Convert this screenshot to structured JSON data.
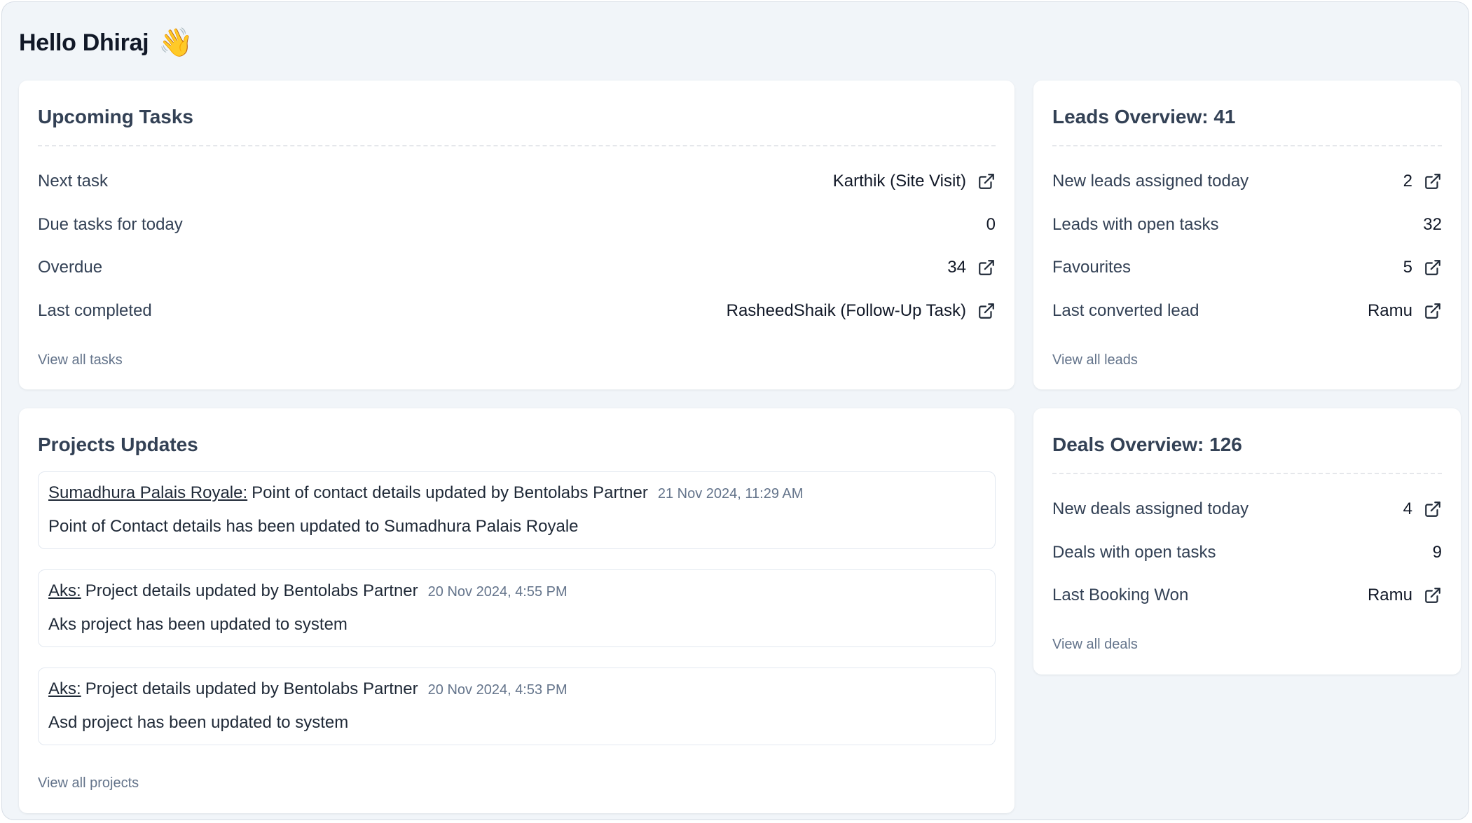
{
  "greeting": {
    "text": "Hello Dhiraj",
    "emoji": "👋"
  },
  "tasks": {
    "title": "Upcoming Tasks",
    "rows": [
      {
        "label": "Next task",
        "value": "Karthik (Site Visit)"
      },
      {
        "label": "Due tasks for today",
        "value": "0"
      },
      {
        "label": "Overdue",
        "value": "34"
      },
      {
        "label": "Last completed",
        "value": "RasheedShaik (Follow-Up Task)"
      }
    ],
    "view_all": "View all tasks"
  },
  "leads": {
    "title": "Leads Overview: 41",
    "rows": [
      {
        "label": "New leads assigned today",
        "value": "2"
      },
      {
        "label": "Leads with open tasks",
        "value": "32"
      },
      {
        "label": "Favourites",
        "value": "5"
      },
      {
        "label": "Last converted lead",
        "value": "Ramu"
      }
    ],
    "view_all": "View all leads"
  },
  "projects": {
    "title": "Projects Updates",
    "updates": [
      {
        "project": "Sumadhura Palais Royale:",
        "message": "Point of contact details updated by Bentolabs Partner",
        "time": "21 Nov 2024, 11:29 AM",
        "detail": "Point of Contact details has been updated to Sumadhura Palais Royale"
      },
      {
        "project": "Aks:",
        "message": "Project details updated by Bentolabs Partner",
        "time": "20 Nov 2024, 4:55 PM",
        "detail": "Aks project has been updated to system"
      },
      {
        "project": "Aks:",
        "message": "Project details updated by Bentolabs Partner",
        "time": "20 Nov 2024, 4:53 PM",
        "detail": "Asd project has been updated to system"
      }
    ],
    "view_all": "View all projects"
  },
  "deals": {
    "title": "Deals Overview: 126",
    "rows": [
      {
        "label": "New deals assigned today",
        "value": "4"
      },
      {
        "label": "Deals with open tasks",
        "value": "9"
      },
      {
        "label": "Last Booking Won",
        "value": "Ramu"
      }
    ],
    "view_all": "View all deals"
  },
  "icons": {
    "external_link": "external-link-icon"
  }
}
